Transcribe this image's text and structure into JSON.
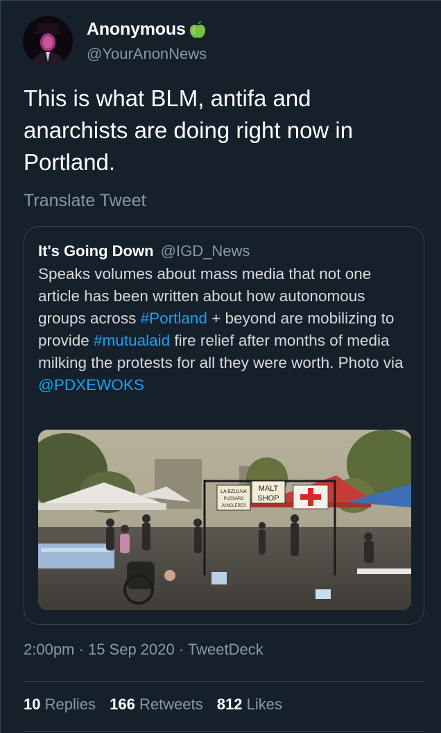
{
  "tweet": {
    "author_name": "Anonymous",
    "author_handle": "@YourAnonNews",
    "author_badge_icon": "green-apple-icon",
    "text": "This is what BLM, antifa and anarchists are doing right now in Portland.",
    "translate_label": "Translate Tweet",
    "time": "2:00pm",
    "date": "15 Sep 2020",
    "source": "TweetDeck",
    "separator": "·"
  },
  "quote": {
    "author_name": "It's Going Down",
    "author_handle": "@IGD_News",
    "text_1": "Speaks volumes about mass media that not one article has been written about how autonomous groups across ",
    "hashtag_1": "#Portland",
    "text_2": " + beyond are mobilizing to provide ",
    "hashtag_2": "#mutualaid",
    "text_3": " fire relief after months of media milking the protests for all they were worth. Photo via ",
    "mention": "@PDXEWOKS",
    "image_signs": {
      "sign_1_line_1": "LA BZULNA",
      "sign_1_line_2": "PUSSARS",
      "sign_1_line_3": "JUNCLERES",
      "sign_2_line_1": "MALT",
      "sign_2_line_2": "SHOP"
    }
  },
  "stats": {
    "replies_count": "10",
    "replies_label": "Replies",
    "retweets_count": "166",
    "retweets_label": "Retweets",
    "likes_count": "812",
    "likes_label": "Likes"
  },
  "colors": {
    "background": "#15202b",
    "link": "#1da1f2",
    "secondary_text": "#8899a6",
    "border": "#38444d"
  }
}
